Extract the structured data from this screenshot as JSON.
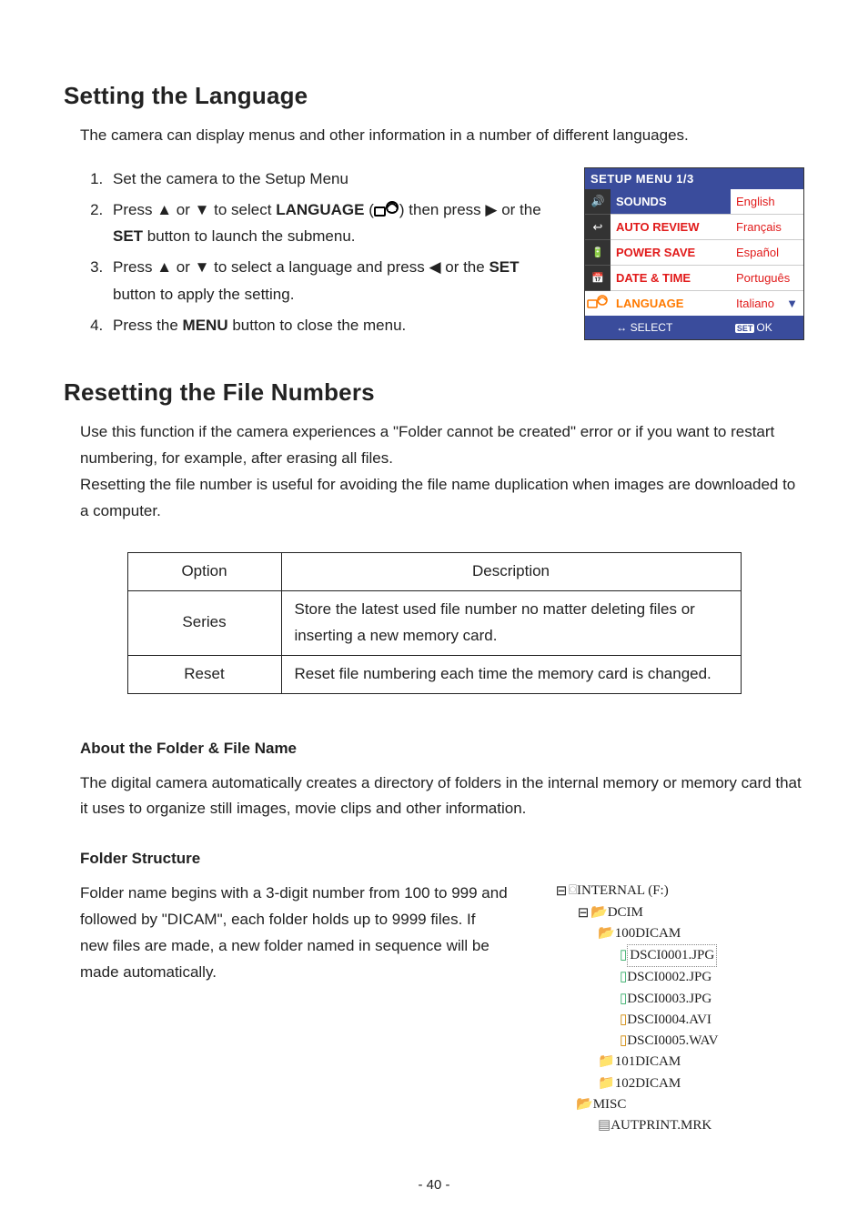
{
  "headings": {
    "lang": "Setting the Language",
    "reset": "Resetting the File Numbers",
    "about": "About the Folder & File Name",
    "folder": "Folder Structure"
  },
  "lang_intro": "The camera can display menus and other information in a number of different languages.",
  "steps": {
    "s1": "Set the camera to the Setup Menu",
    "s2a": "Press ",
    "s2b": " or ",
    "s2c": " to select ",
    "s2_lang": "LANGUAGE",
    "s2d": " (",
    "s2e": ") then press ",
    "s2f": " or the ",
    "s2_set": "SET",
    "s2g": " button to launch the submenu.",
    "s3a": "Press ",
    "s3b": " or ",
    "s3c": " to select a language and press ",
    "s3d": " or the ",
    "s3_set": "SET",
    "s3e": " button to apply the setting.",
    "s4a": "Press the ",
    "s4_menu": "MENU",
    "s4b": " button to close the menu."
  },
  "setup_menu": {
    "title": "SETUP MENU 1/3",
    "rows": [
      {
        "label": "SOUNDS",
        "value": "English"
      },
      {
        "label": "AUTO REVIEW",
        "value": "Français"
      },
      {
        "label": "POWER SAVE",
        "value": "Español"
      },
      {
        "label": "DATE & TIME",
        "value": "Português"
      },
      {
        "label": "LANGUAGE",
        "value": "Italiano"
      }
    ],
    "footer_left": "SELECT",
    "footer_right": "OK",
    "footer_set": "SET"
  },
  "reset_intro1": "Use this function if the camera experiences a \"Folder cannot be created\" error or if you want to restart numbering, for example, after erasing all files.",
  "reset_intro2": "Resetting the file number is useful for avoiding the file name duplication when images are downloaded to a computer.",
  "table": {
    "h_option": "Option",
    "h_desc": "Description",
    "r1_opt": "Series",
    "r1_desc": "Store the latest used file number no matter deleting files or inserting a new memory card.",
    "r2_opt": "Reset",
    "r2_desc": "Reset file numbering each time the memory card is changed."
  },
  "about_text": "The digital camera automatically creates a directory of folders in the internal memory or memory card that it uses to organize still images, movie clips and other information.",
  "folder_text": "Folder name begins with a 3-digit number from 100 to 999 and followed by \"DICAM\", each folder holds up to 9999 files.   If new files are made, a new folder named in sequence will be made automatically.",
  "tree": {
    "root": "INTERNAL (F:)",
    "dcim": "DCIM",
    "f100": "100DICAM",
    "files": [
      "DSCI0001.JPG",
      "DSCI0002.JPG",
      "DSCI0003.JPG",
      "DSCI0004.AVI",
      "DSCI0005.WAV"
    ],
    "f101": "101DICAM",
    "f102": "102DICAM",
    "misc": "MISC",
    "autoprint": "AUTPRINT.MRK"
  },
  "page_number": "- 40 -"
}
